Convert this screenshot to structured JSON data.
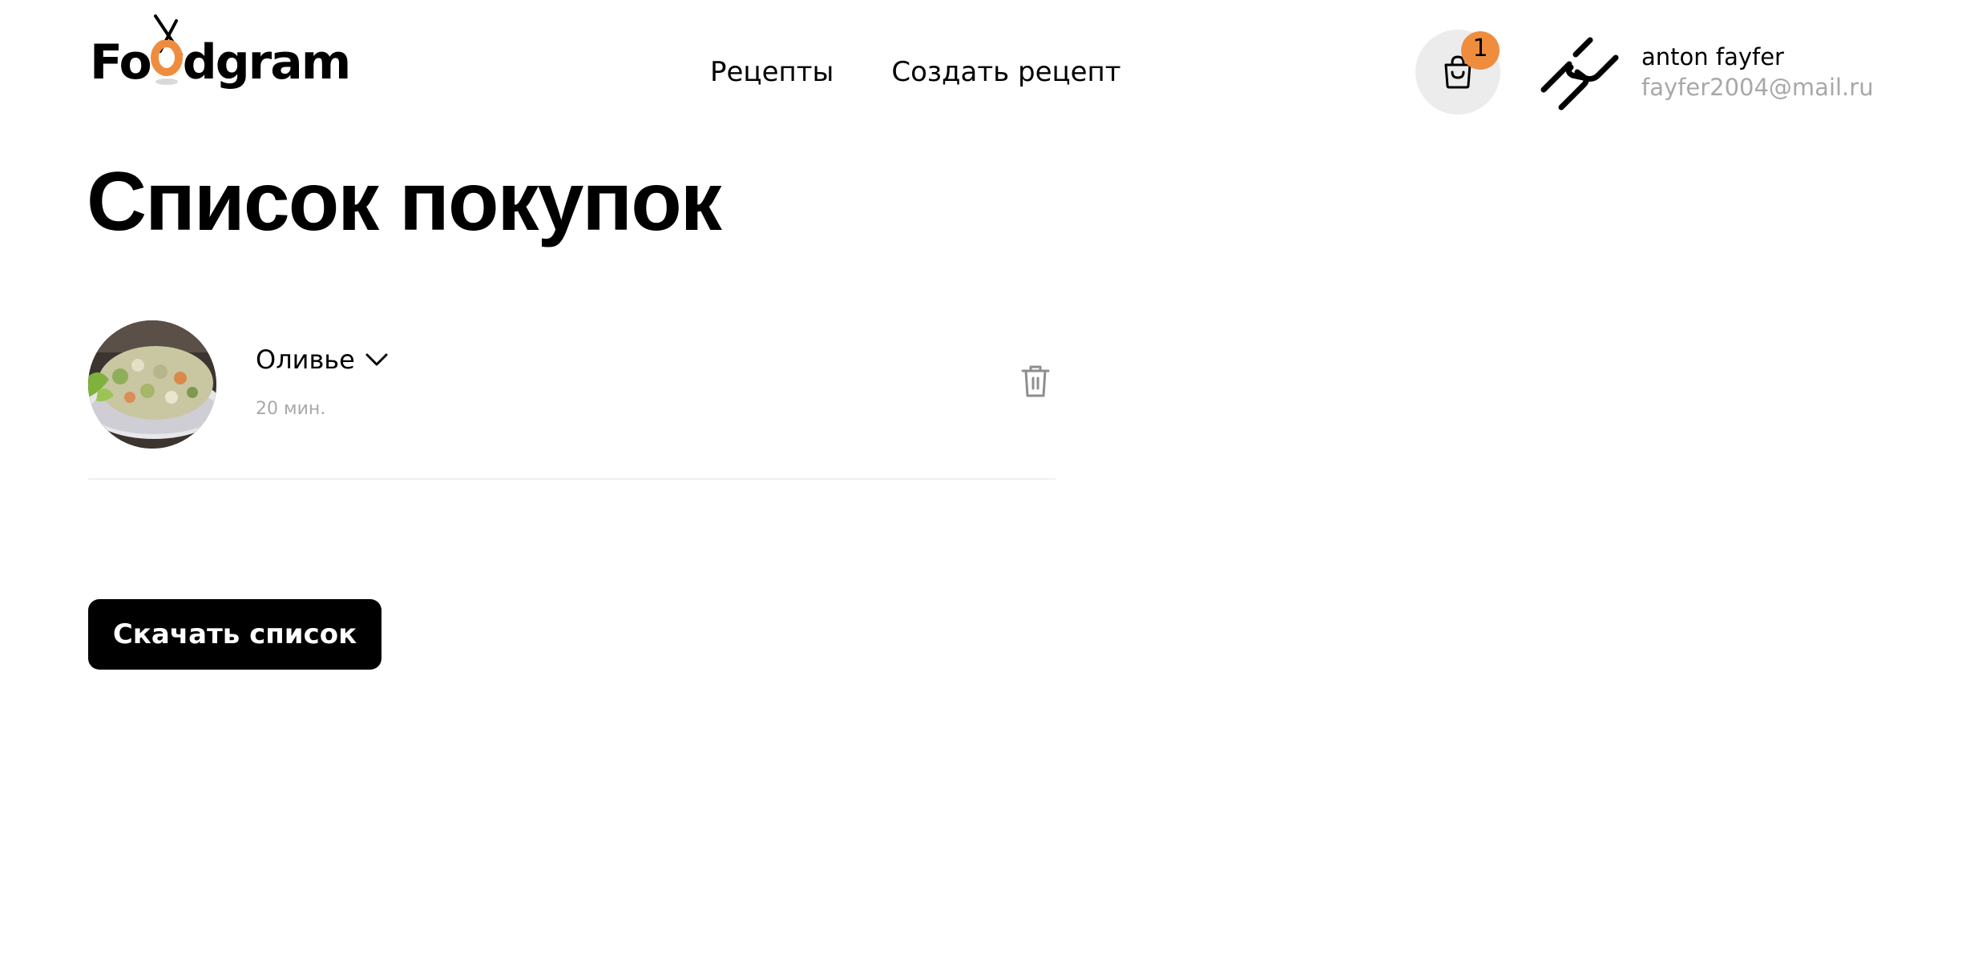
{
  "header": {
    "logo": {
      "text_before": "Fo",
      "text_after": "dgram",
      "accent_color": "#ef8d3f"
    },
    "nav": [
      {
        "label": "Рецепты"
      },
      {
        "label": "Создать рецепт"
      }
    ],
    "cart": {
      "icon": "shopping-bag-icon",
      "count": "1",
      "badge_color": "#ef8d3f"
    },
    "user": {
      "avatar_icon": "chain-link-avatar-icon",
      "name": "anton fayfer",
      "email": "fayfer2004@mail.ru"
    }
  },
  "main": {
    "title": "Список покупок",
    "items": [
      {
        "name": "Оливье",
        "time": "20 мин.",
        "expand_icon": "chevron-down-icon",
        "delete_icon": "trash-icon"
      }
    ],
    "download_button": "Скачать список"
  }
}
